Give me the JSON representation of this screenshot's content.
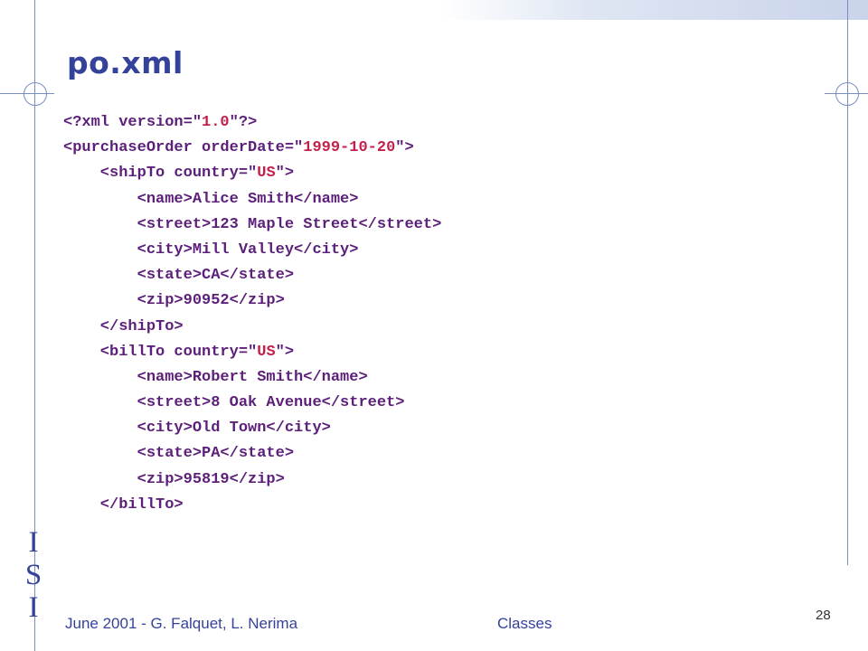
{
  "slide": {
    "title": "po.xml"
  },
  "code_lines": [
    [
      {
        "t": "<?xml version=\"",
        "k": "tag"
      },
      {
        "t": "1.0",
        "k": "str"
      },
      {
        "t": "\"?>",
        "k": "tag"
      }
    ],
    [
      {
        "t": "<purchaseOrder orderDate=\"",
        "k": "tag"
      },
      {
        "t": "1999-10-20",
        "k": "str"
      },
      {
        "t": "\">",
        "k": "tag"
      }
    ],
    [
      {
        "t": "    <shipTo country=\"",
        "k": "tag"
      },
      {
        "t": "US",
        "k": "str"
      },
      {
        "t": "\">",
        "k": "tag"
      }
    ],
    [
      {
        "t": "        <name>Alice Smith</name>",
        "k": "tag"
      }
    ],
    [
      {
        "t": "        <street>123 Maple Street</street>",
        "k": "tag"
      }
    ],
    [
      {
        "t": "        <city>Mill Valley</city>",
        "k": "tag"
      }
    ],
    [
      {
        "t": "        <state>CA</state>",
        "k": "tag"
      }
    ],
    [
      {
        "t": "        <zip>90952</zip>",
        "k": "tag"
      }
    ],
    [
      {
        "t": "    </shipTo>",
        "k": "tag"
      }
    ],
    [
      {
        "t": "    <billTo country=\"",
        "k": "tag"
      },
      {
        "t": "US",
        "k": "str"
      },
      {
        "t": "\">",
        "k": "tag"
      }
    ],
    [
      {
        "t": "        <name>Robert Smith</name>",
        "k": "tag"
      }
    ],
    [
      {
        "t": "        <street>8 Oak Avenue</street>",
        "k": "tag"
      }
    ],
    [
      {
        "t": "        <city>Old Town</city>",
        "k": "tag"
      }
    ],
    [
      {
        "t": "        <state>PA</state>",
        "k": "tag"
      }
    ],
    [
      {
        "t": "        <zip>95819</zip>",
        "k": "tag"
      }
    ],
    [
      {
        "t": "    </billTo>",
        "k": "tag"
      }
    ]
  ],
  "logo": {
    "letters": [
      "I",
      "S",
      "I"
    ]
  },
  "footer": {
    "author": "June 2001 - G. Falquet, L. Nerima",
    "topic": "Classes",
    "page_number": "28"
  },
  "colors": {
    "title": "#35429a",
    "tag": "#5c1f7a",
    "string": "#c3214c",
    "decoration": "#7a8fc0"
  }
}
